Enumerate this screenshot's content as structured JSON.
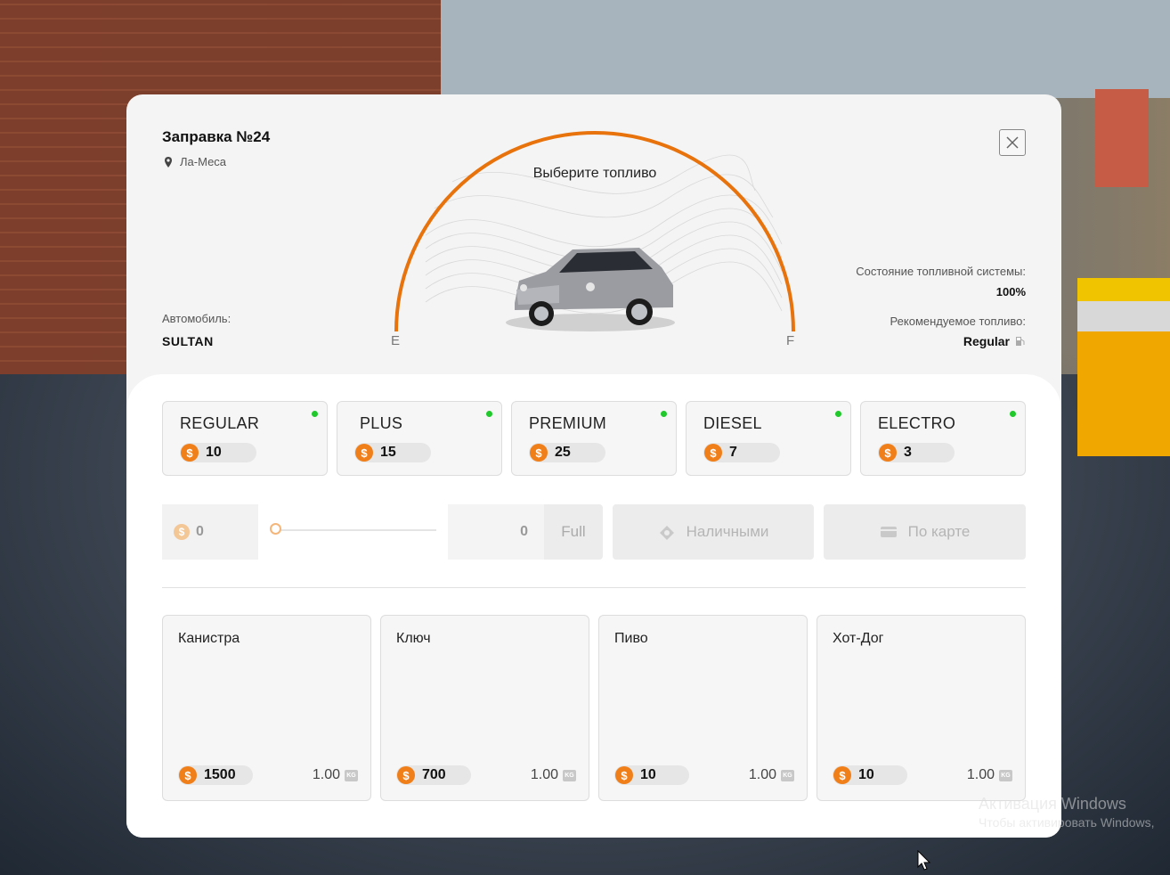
{
  "station": {
    "title": "Заправка №24",
    "location": "Ла-Меса"
  },
  "vehicle": {
    "label": "Автомобиль:",
    "name": "SULTAN"
  },
  "gauge": {
    "title": "Выберите топливо",
    "empty": "E",
    "full": "F",
    "level": 1.0
  },
  "system": {
    "status_label": "Состояние топливной системы:",
    "status_value": "100%",
    "recommended_label": "Рекомендуемое топливо:",
    "recommended_value": "Regular"
  },
  "fuels": [
    {
      "name": "REGULAR",
      "price": "10",
      "available": true
    },
    {
      "name": "PLUS",
      "price": "15",
      "available": true
    },
    {
      "name": "PREMIUM",
      "price": "25",
      "available": true
    },
    {
      "name": "DIESEL",
      "price": "7",
      "available": true
    },
    {
      "name": "ELECTRO",
      "price": "3",
      "available": true
    }
  ],
  "controls": {
    "cost": "0",
    "liters": "0",
    "full_label": "Full",
    "cash_label": "Наличными",
    "card_label": "По карте",
    "slider_value": 0
  },
  "items": [
    {
      "name": "Канистра",
      "price": "1500",
      "weight": "1.00",
      "unit": "KG"
    },
    {
      "name": "Ключ",
      "price": "700",
      "weight": "1.00",
      "unit": "KG"
    },
    {
      "name": "Пиво",
      "price": "10",
      "weight": "1.00",
      "unit": "KG"
    },
    {
      "name": "Хот-Дог",
      "price": "10",
      "weight": "1.00",
      "unit": "KG"
    }
  ],
  "currency_symbol": "$",
  "watermark": {
    "title": "Активация Windows",
    "subtitle": "Чтобы активировать Windows,"
  },
  "colors": {
    "accent": "#e8720c",
    "available": "#1fc92a",
    "panel": "#f4f4f4"
  }
}
